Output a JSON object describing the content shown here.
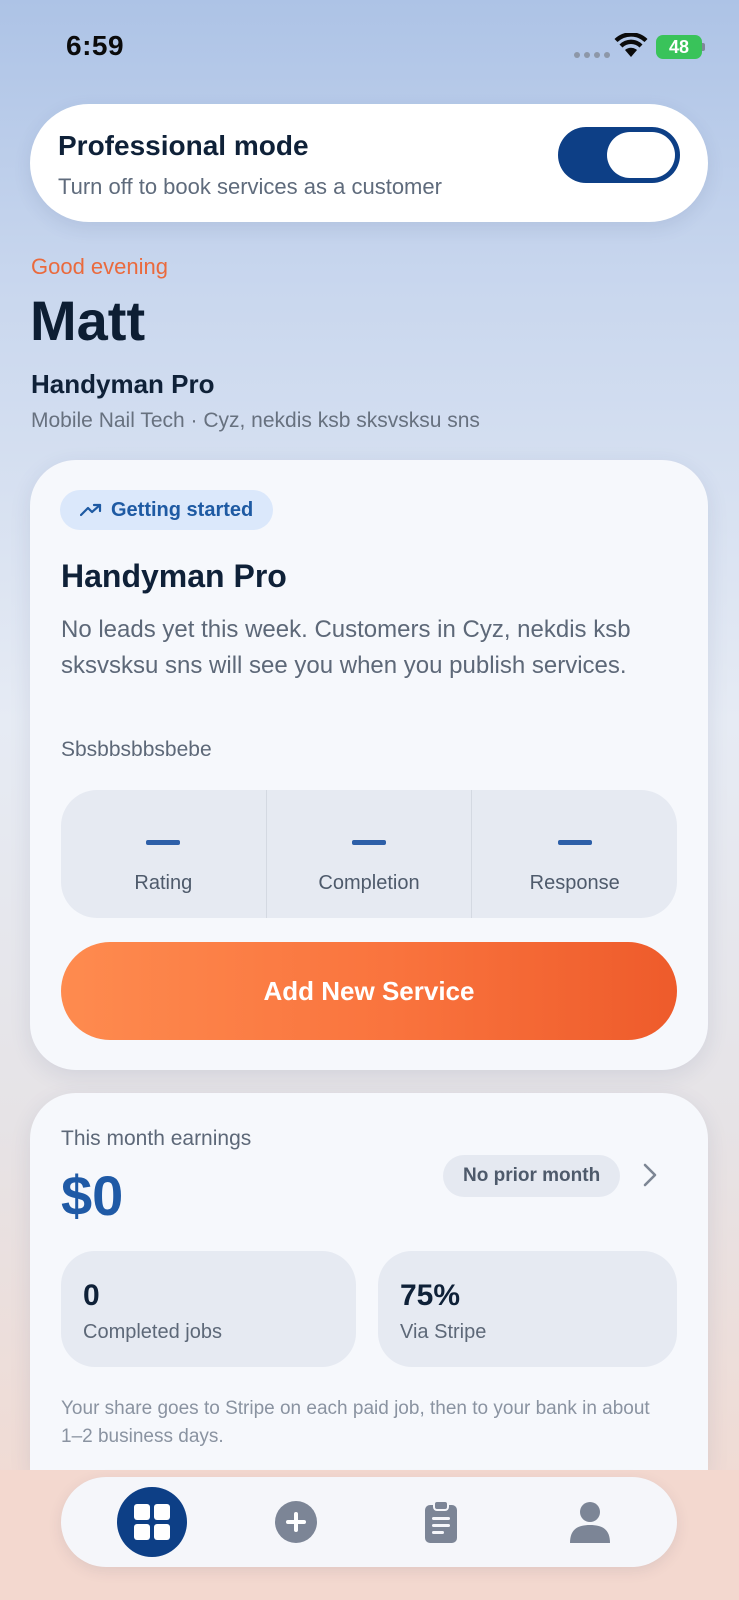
{
  "status_bar": {
    "time": "6:59",
    "battery": "48"
  },
  "pro_mode": {
    "title": "Professional mode",
    "subtitle": "Turn off to book services as a customer",
    "enabled": true
  },
  "greeting": {
    "salutation": "Good evening",
    "name": "Matt",
    "business": "Handyman Pro",
    "business_detail": "Mobile Nail Tech · Cyz, nekdis ksb sksvsksu sns"
  },
  "main_card": {
    "badge": "Getting started",
    "title": "Handyman Pro",
    "description": "No leads yet this week. Customers in Cyz, nekdis ksb sksvsksu sns will see you when you publish services.",
    "note": "Sbsbbsbbsbebe",
    "stats": [
      {
        "label": "Rating"
      },
      {
        "label": "Completion"
      },
      {
        "label": "Response"
      }
    ],
    "cta_label": "Add New Service"
  },
  "earnings": {
    "label": "This month earnings",
    "value": "$0",
    "prior_label": "No prior month",
    "tiles": [
      {
        "value": "0",
        "label": "Completed jobs"
      },
      {
        "value": "75%",
        "label": "Via Stripe"
      }
    ],
    "note": "Your share goes to Stripe on each paid job, then to your bank in about 1–2 business days."
  },
  "tab_bar": {
    "tabs": [
      {
        "icon": "grid-icon",
        "active": true
      },
      {
        "icon": "plus-circle-icon",
        "active": false
      },
      {
        "icon": "clipboard-icon",
        "active": false
      },
      {
        "icon": "person-icon",
        "active": false
      }
    ]
  },
  "colors": {
    "primary": "#0d3f86",
    "accent": "#f9733d",
    "money": "#1f5aa6",
    "greeting": "#ea6a3d"
  }
}
